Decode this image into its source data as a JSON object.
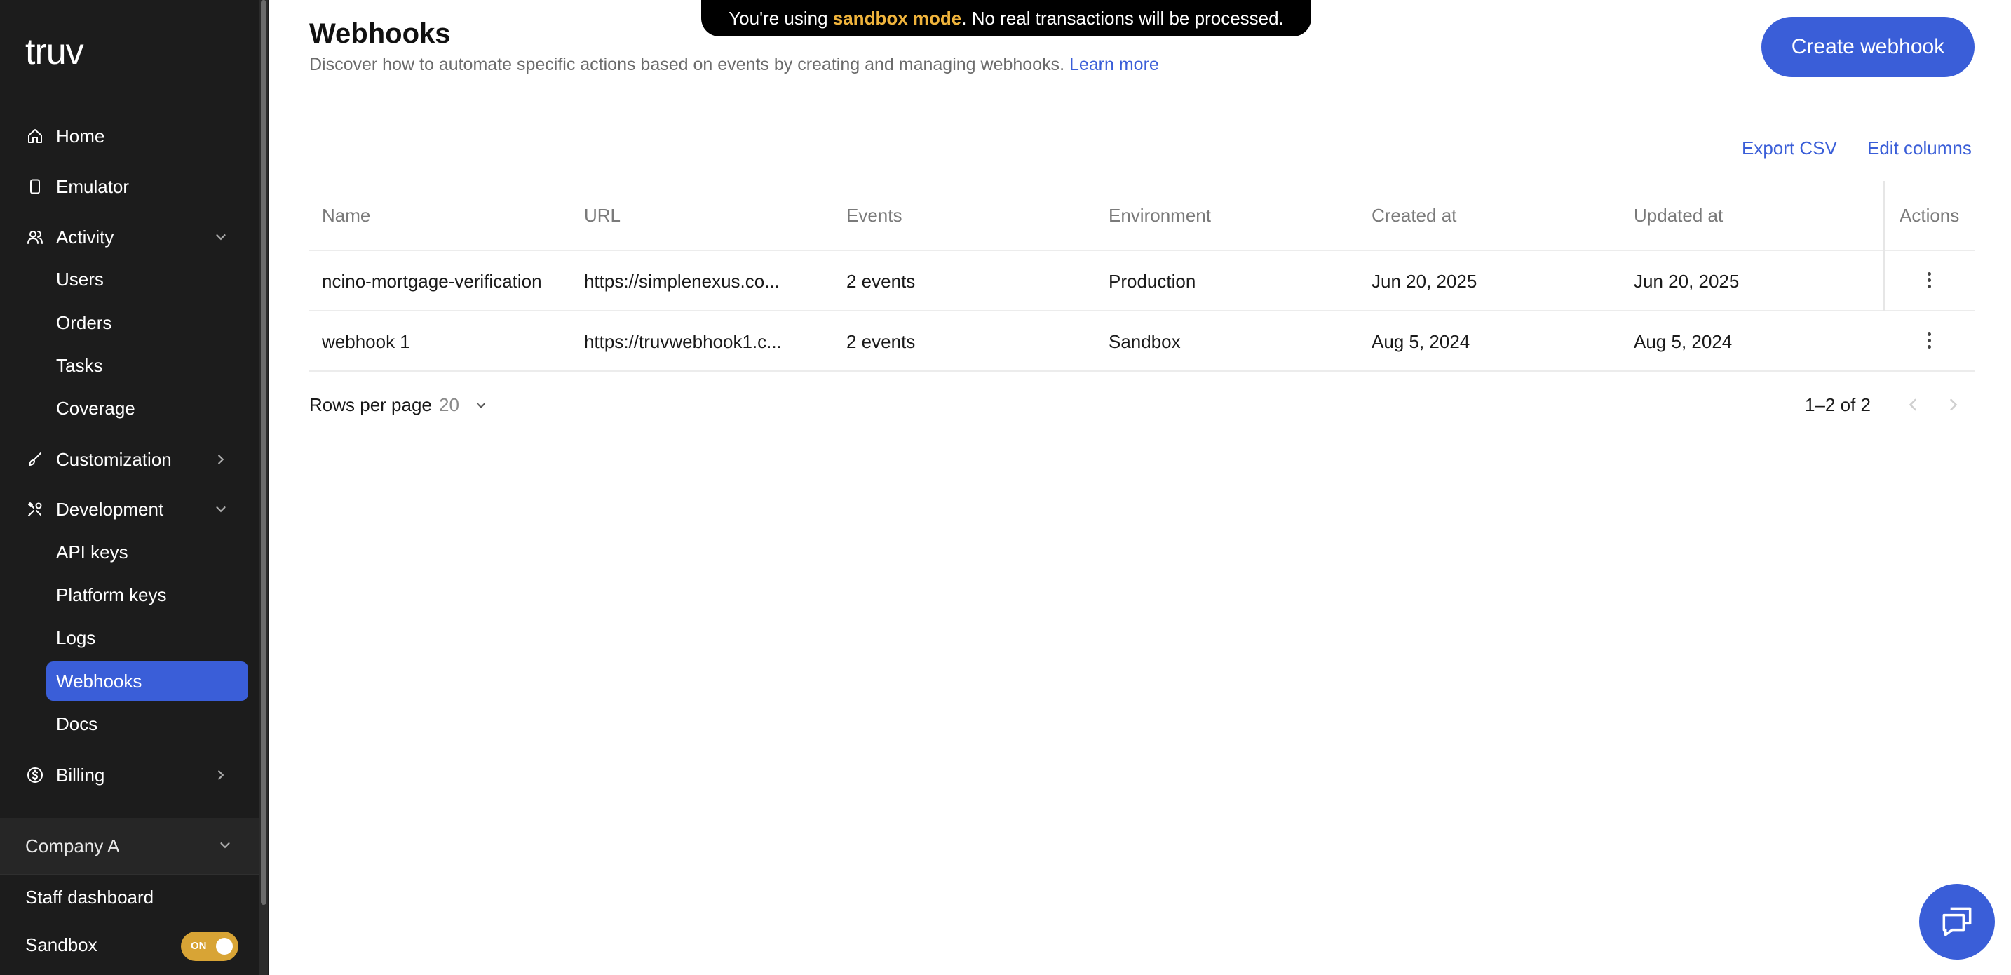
{
  "sidebar": {
    "logo": "truv",
    "items": [
      {
        "label": "Home"
      },
      {
        "label": "Emulator"
      },
      {
        "label": "Activity"
      },
      {
        "label": "Customization"
      },
      {
        "label": "Development"
      },
      {
        "label": "Billing"
      }
    ],
    "activity_sub": [
      "Users",
      "Orders",
      "Tasks",
      "Coverage"
    ],
    "development_sub": [
      "API keys",
      "Platform keys",
      "Logs",
      "Webhooks",
      "Docs"
    ],
    "active_item": "Webhooks",
    "company": "Company A",
    "staff_dashboard": "Staff dashboard",
    "sandbox_label": "Sandbox",
    "sandbox_toggle": "ON"
  },
  "banner": {
    "prefix": "You're using ",
    "highlight": "sandbox mode",
    "suffix": ". No real transactions will be processed."
  },
  "header": {
    "title": "Webhooks",
    "subtitle": "Discover how to automate specific actions based on events by creating and managing webhooks.",
    "learn_more": "Learn more",
    "create_button": "Create webhook"
  },
  "toolbar": {
    "export_csv": "Export CSV",
    "edit_columns": "Edit columns"
  },
  "table": {
    "columns": [
      "Name",
      "URL",
      "Events",
      "Environment",
      "Created at",
      "Updated at",
      "Actions"
    ],
    "rows": [
      {
        "name": "ncino-mortgage-verification",
        "url": "https://simplenexus.co...",
        "events": "2 events",
        "environment": "Production",
        "created_at": "Jun 20, 2025",
        "updated_at": "Jun 20, 2025"
      },
      {
        "name": "webhook 1",
        "url": "https://truvwebhook1.c...",
        "events": "2 events",
        "environment": "Sandbox",
        "created_at": "Aug 5, 2024",
        "updated_at": "Aug 5, 2024"
      }
    ]
  },
  "pagination": {
    "rows_per_page_label": "Rows per page",
    "rows_per_page_value": "20",
    "range": "1–2 of 2"
  },
  "colors": {
    "accent": "#3a5ed8",
    "sidebar_bg": "#1c1c1c",
    "banner_highlight": "#f0b43c",
    "toggle": "#d8a435"
  },
  "icons": [
    "home-icon",
    "phone-icon",
    "users-icon",
    "brush-icon",
    "tools-icon",
    "dollar-icon",
    "chevron-down-icon",
    "chevron-right-icon",
    "more-vertical-icon",
    "chevron-left-icon",
    "chat-icon"
  ]
}
